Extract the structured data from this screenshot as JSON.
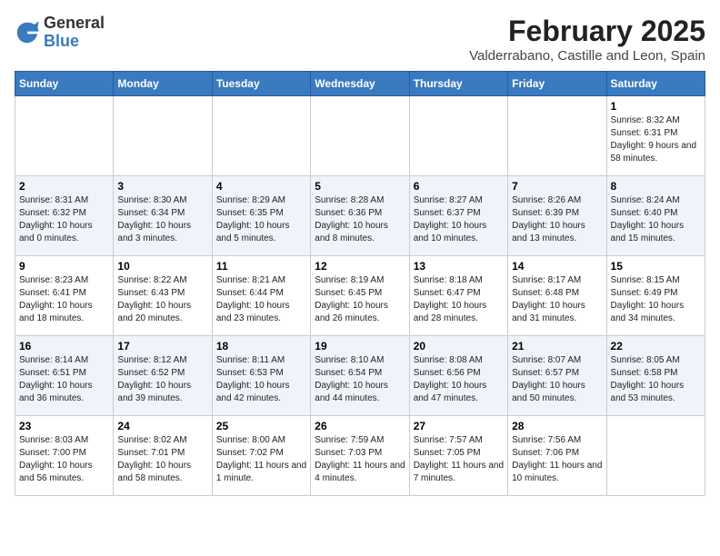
{
  "header": {
    "logo_general": "General",
    "logo_blue": "Blue",
    "month_title": "February 2025",
    "location": "Valderrabano, Castille and Leon, Spain"
  },
  "days_of_week": [
    "Sunday",
    "Monday",
    "Tuesday",
    "Wednesday",
    "Thursday",
    "Friday",
    "Saturday"
  ],
  "weeks": [
    [
      {
        "day": "",
        "info": ""
      },
      {
        "day": "",
        "info": ""
      },
      {
        "day": "",
        "info": ""
      },
      {
        "day": "",
        "info": ""
      },
      {
        "day": "",
        "info": ""
      },
      {
        "day": "",
        "info": ""
      },
      {
        "day": "1",
        "info": "Sunrise: 8:32 AM\nSunset: 6:31 PM\nDaylight: 9 hours and 58 minutes."
      }
    ],
    [
      {
        "day": "2",
        "info": "Sunrise: 8:31 AM\nSunset: 6:32 PM\nDaylight: 10 hours and 0 minutes."
      },
      {
        "day": "3",
        "info": "Sunrise: 8:30 AM\nSunset: 6:34 PM\nDaylight: 10 hours and 3 minutes."
      },
      {
        "day": "4",
        "info": "Sunrise: 8:29 AM\nSunset: 6:35 PM\nDaylight: 10 hours and 5 minutes."
      },
      {
        "day": "5",
        "info": "Sunrise: 8:28 AM\nSunset: 6:36 PM\nDaylight: 10 hours and 8 minutes."
      },
      {
        "day": "6",
        "info": "Sunrise: 8:27 AM\nSunset: 6:37 PM\nDaylight: 10 hours and 10 minutes."
      },
      {
        "day": "7",
        "info": "Sunrise: 8:26 AM\nSunset: 6:39 PM\nDaylight: 10 hours and 13 minutes."
      },
      {
        "day": "8",
        "info": "Sunrise: 8:24 AM\nSunset: 6:40 PM\nDaylight: 10 hours and 15 minutes."
      }
    ],
    [
      {
        "day": "9",
        "info": "Sunrise: 8:23 AM\nSunset: 6:41 PM\nDaylight: 10 hours and 18 minutes."
      },
      {
        "day": "10",
        "info": "Sunrise: 8:22 AM\nSunset: 6:43 PM\nDaylight: 10 hours and 20 minutes."
      },
      {
        "day": "11",
        "info": "Sunrise: 8:21 AM\nSunset: 6:44 PM\nDaylight: 10 hours and 23 minutes."
      },
      {
        "day": "12",
        "info": "Sunrise: 8:19 AM\nSunset: 6:45 PM\nDaylight: 10 hours and 26 minutes."
      },
      {
        "day": "13",
        "info": "Sunrise: 8:18 AM\nSunset: 6:47 PM\nDaylight: 10 hours and 28 minutes."
      },
      {
        "day": "14",
        "info": "Sunrise: 8:17 AM\nSunset: 6:48 PM\nDaylight: 10 hours and 31 minutes."
      },
      {
        "day": "15",
        "info": "Sunrise: 8:15 AM\nSunset: 6:49 PM\nDaylight: 10 hours and 34 minutes."
      }
    ],
    [
      {
        "day": "16",
        "info": "Sunrise: 8:14 AM\nSunset: 6:51 PM\nDaylight: 10 hours and 36 minutes."
      },
      {
        "day": "17",
        "info": "Sunrise: 8:12 AM\nSunset: 6:52 PM\nDaylight: 10 hours and 39 minutes."
      },
      {
        "day": "18",
        "info": "Sunrise: 8:11 AM\nSunset: 6:53 PM\nDaylight: 10 hours and 42 minutes."
      },
      {
        "day": "19",
        "info": "Sunrise: 8:10 AM\nSunset: 6:54 PM\nDaylight: 10 hours and 44 minutes."
      },
      {
        "day": "20",
        "info": "Sunrise: 8:08 AM\nSunset: 6:56 PM\nDaylight: 10 hours and 47 minutes."
      },
      {
        "day": "21",
        "info": "Sunrise: 8:07 AM\nSunset: 6:57 PM\nDaylight: 10 hours and 50 minutes."
      },
      {
        "day": "22",
        "info": "Sunrise: 8:05 AM\nSunset: 6:58 PM\nDaylight: 10 hours and 53 minutes."
      }
    ],
    [
      {
        "day": "23",
        "info": "Sunrise: 8:03 AM\nSunset: 7:00 PM\nDaylight: 10 hours and 56 minutes."
      },
      {
        "day": "24",
        "info": "Sunrise: 8:02 AM\nSunset: 7:01 PM\nDaylight: 10 hours and 58 minutes."
      },
      {
        "day": "25",
        "info": "Sunrise: 8:00 AM\nSunset: 7:02 PM\nDaylight: 11 hours and 1 minute."
      },
      {
        "day": "26",
        "info": "Sunrise: 7:59 AM\nSunset: 7:03 PM\nDaylight: 11 hours and 4 minutes."
      },
      {
        "day": "27",
        "info": "Sunrise: 7:57 AM\nSunset: 7:05 PM\nDaylight: 11 hours and 7 minutes."
      },
      {
        "day": "28",
        "info": "Sunrise: 7:56 AM\nSunset: 7:06 PM\nDaylight: 11 hours and 10 minutes."
      },
      {
        "day": "",
        "info": ""
      }
    ]
  ]
}
